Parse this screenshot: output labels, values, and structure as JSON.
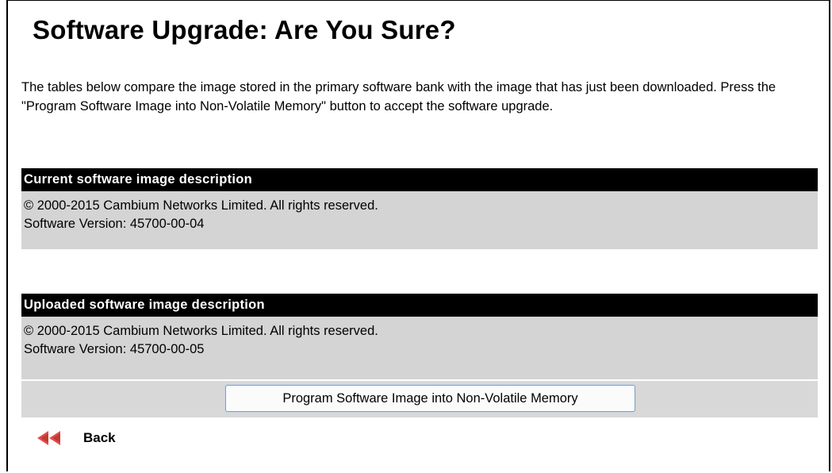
{
  "page": {
    "title": "Software Upgrade: Are You Sure?",
    "intro": "The tables below compare the image stored in the primary software bank with the image that has just been downloaded. Press the \"Program Software Image into Non-Volatile Memory\" button to accept the software upgrade."
  },
  "current": {
    "header": "Current software image description",
    "copyright": "© 2000-2015 Cambium Networks Limited. All rights reserved.",
    "version": "Software Version: 45700-00-04"
  },
  "uploaded": {
    "header": "Uploaded software image description",
    "copyright": "© 2000-2015 Cambium Networks Limited. All rights reserved.",
    "version": "Software Version: 45700-00-05"
  },
  "actions": {
    "program_label": "Program Software Image into Non-Volatile Memory",
    "back_label": "Back",
    "back_icon": "double-left-arrow-icon"
  },
  "colors": {
    "header_bg": "#000000",
    "header_fg": "#ffffff",
    "body_bg": "#d4d4d4",
    "back_arrow": "#e0504a"
  }
}
